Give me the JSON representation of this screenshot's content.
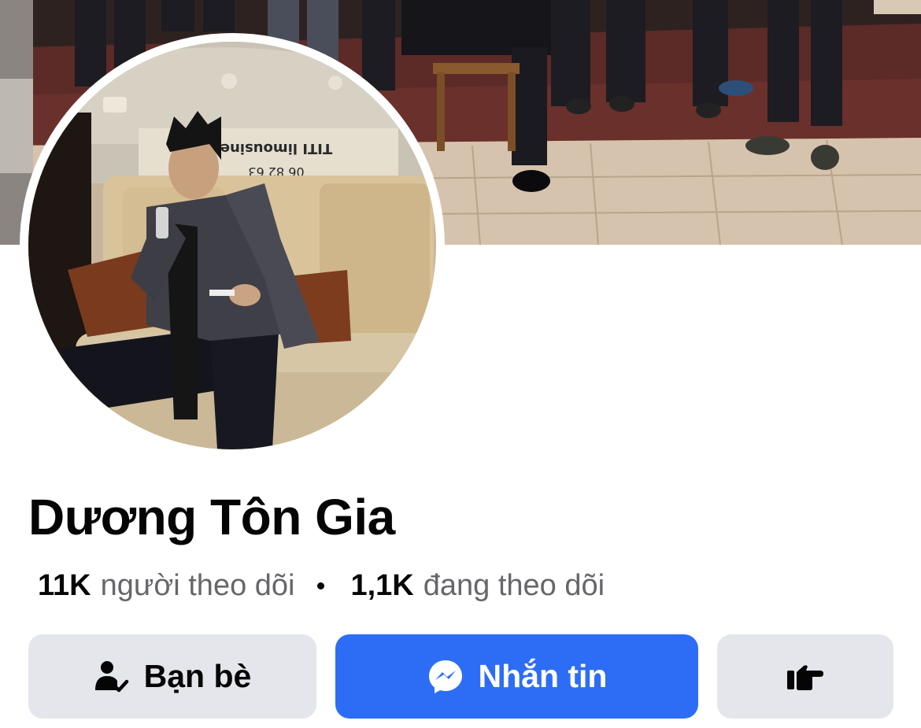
{
  "profile": {
    "name": "Dương Tôn Gia"
  },
  "stats": {
    "followers_count": "11K",
    "followers_label": "người theo dõi",
    "following_count": "1,1K",
    "following_label": "đang theo dõi"
  },
  "actions": {
    "friends_label": "Bạn bè",
    "message_label": "Nhắn tin"
  },
  "cover_photo": {
    "banner_text_1": "TITI limousine",
    "banner_text_2": "06 82 63"
  },
  "icons": {
    "friends": "person-check-icon",
    "message": "messenger-icon",
    "more": "pointing-hand-icon"
  },
  "colors": {
    "primary": "#2d6df6",
    "secondary_button": "#e4e6eb",
    "text_primary": "#050505",
    "text_secondary": "#65676b"
  }
}
